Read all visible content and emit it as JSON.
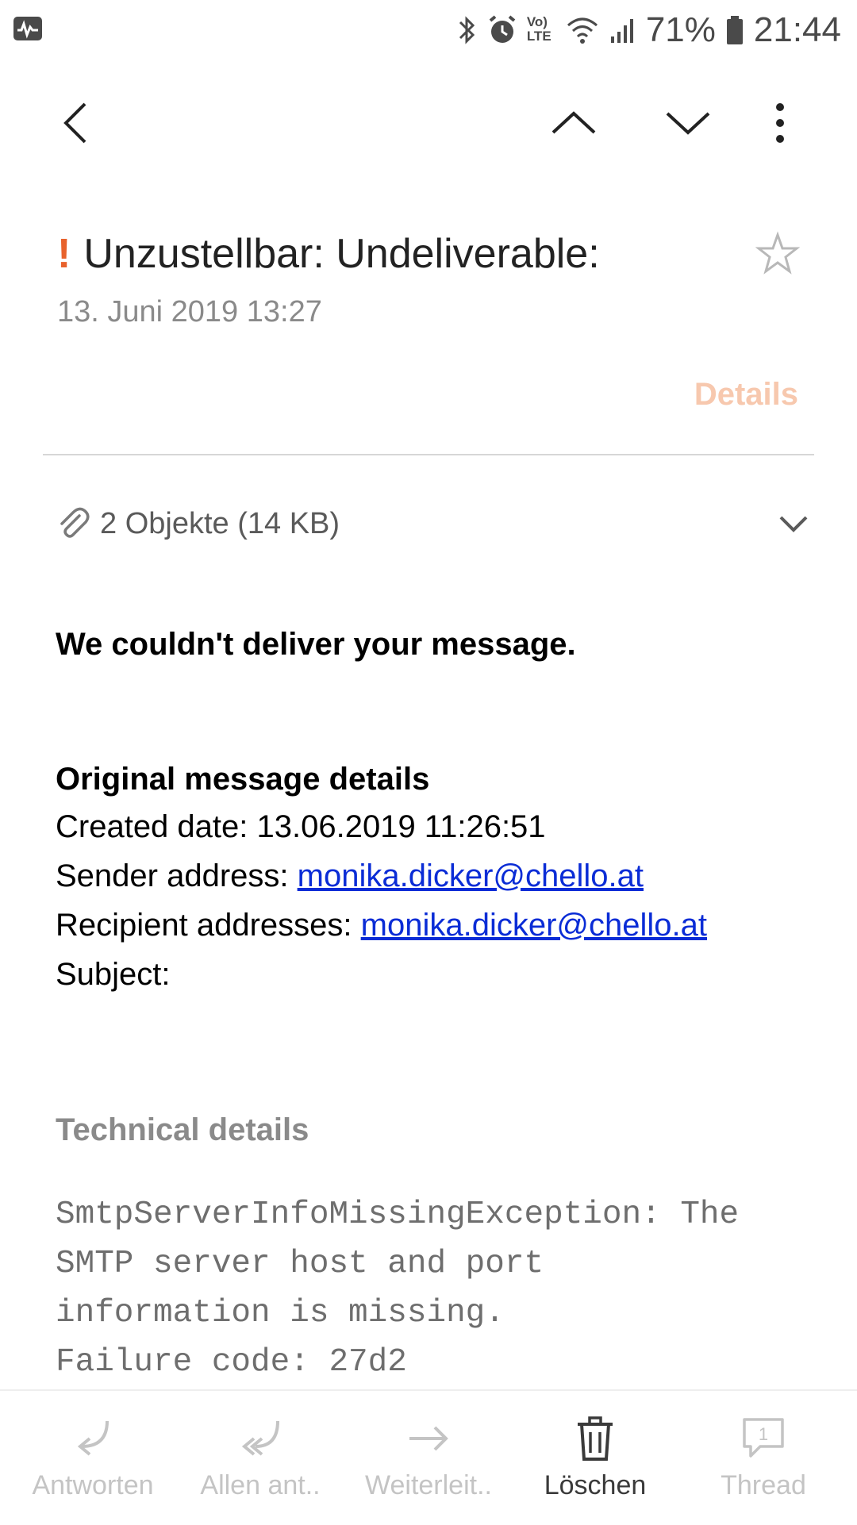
{
  "status_bar": {
    "battery": "71%",
    "time": "21:44",
    "network": "LTE"
  },
  "toolbar": {
    "back_icon": "chevron-left-icon",
    "prev_icon": "chevron-up-icon",
    "next_icon": "chevron-down-icon",
    "more_icon": "more-vertical-icon"
  },
  "email": {
    "priority_mark": "!",
    "subject": "Unzustellbar: Undeliverable:",
    "date": "13. Juni 2019  13:27",
    "details_label": "Details",
    "attachments": "2 Objekte (14 KB)",
    "body": {
      "heading": "We couldn't deliver your message.",
      "original_title": "Original message details",
      "created_label": "Created date: ",
      "created_value": "13.06.2019 11:26:51",
      "sender_label": "Sender address: ",
      "sender_value": "monika.dicker@chello.at",
      "recipient_label": "Recipient addresses: ",
      "recipient_value": "monika.dicker@chello.at",
      "subject_label": "Subject:",
      "tech_title": "Technical details",
      "tech_line1": "SmtpServerInfoMissingException: The",
      "tech_line2": "SMTP server host and port",
      "tech_line3": "information is missing.",
      "tech_line4": "Failure code: 27d2"
    }
  },
  "bottom_bar": {
    "reply": "Antworten",
    "reply_all": "Allen ant..",
    "forward": "Weiterleit..",
    "delete": "Löschen",
    "thread": "Thread",
    "thread_count": "1"
  },
  "colors": {
    "priority": "#e8622c",
    "details": "#f7c8ae",
    "link": "#0a2cd6"
  }
}
